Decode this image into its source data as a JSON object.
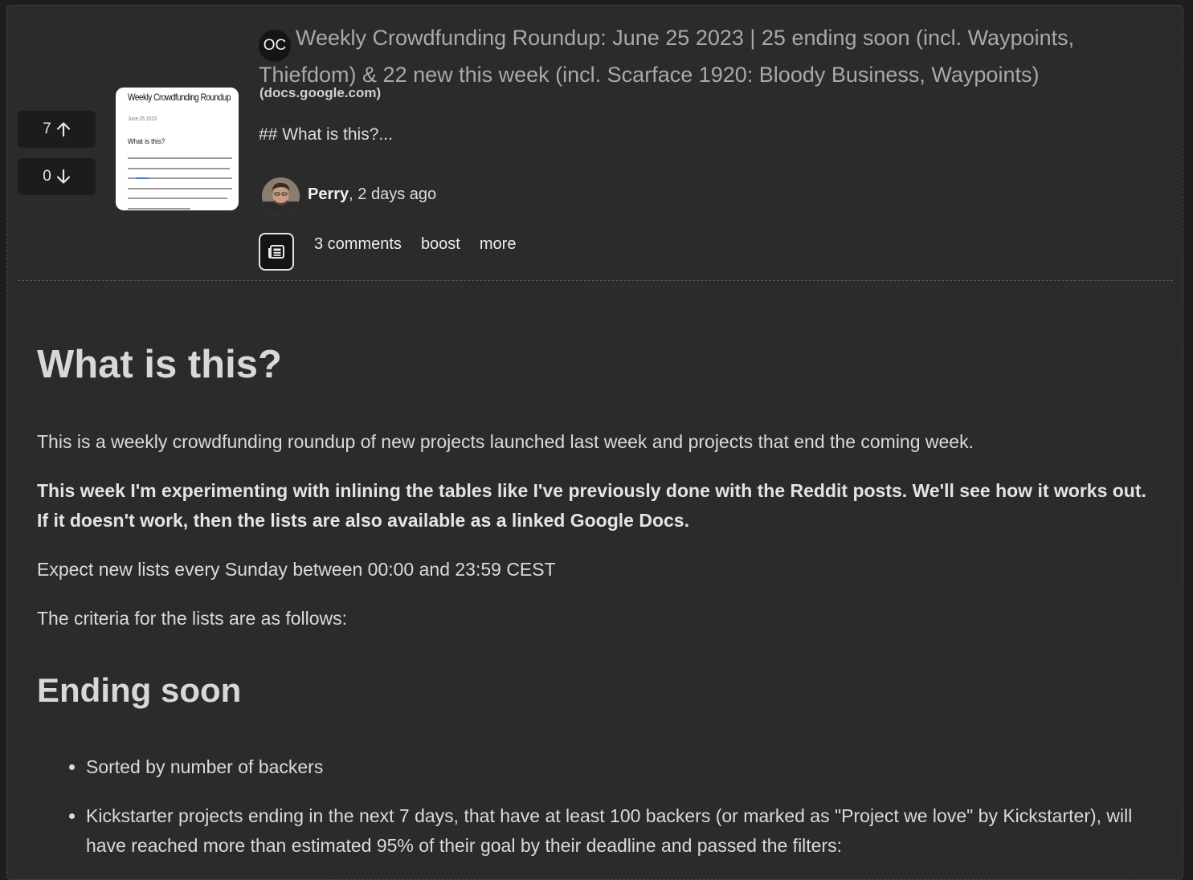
{
  "votes": {
    "up_count": "7",
    "down_count": "0",
    "up_icon": "arrow-up-icon",
    "down_icon": "arrow-down-icon"
  },
  "thumbnail": {
    "title": "Weekly Crowdfunding Roundup",
    "date": "June 25 2023",
    "heading": "What is this?"
  },
  "post": {
    "badge": "OC",
    "title": "Weekly Crowdfunding Roundup: June 25 2023 | 25 ending soon (incl. Waypoints, Thiefdom) & 22 new this week (incl. Scarface 1920: Bloody Business, Waypoints)",
    "domain": "(docs.google.com)",
    "excerpt": "## What is this?...",
    "author": "Perry",
    "time": ", 2 days ago",
    "type_icon": "newspaper-icon"
  },
  "actions": {
    "comments": "3 comments",
    "boost": "boost",
    "more": "more"
  },
  "body": {
    "heading1": "What is this?",
    "para1": "This is a weekly crowdfunding roundup of new projects launched last week and projects that end the coming week.",
    "para2": "This week I'm experimenting with inlining the tables like I've previously done with the Reddit posts. We'll see how it works out. If it doesn't work, then the lists are also available as a linked Google Docs.",
    "para3": "Expect new lists every Sunday between 00:00 and 23:59 CEST",
    "para4": "The criteria for the lists are as follows:",
    "heading2": "Ending soon",
    "list": [
      "Sorted by number of backers",
      "Kickstarter projects ending in the next 7 days, that have at least 100 backers (or marked as \"Project we love\" by Kickstarter), will have reached more than estimated 95% of their goal by their deadline and passed the filters:"
    ]
  },
  "colors": {
    "background": "#2b2b2b",
    "outer": "#1e1e1e",
    "title": "#a9a9a9",
    "text": "#dadada"
  }
}
